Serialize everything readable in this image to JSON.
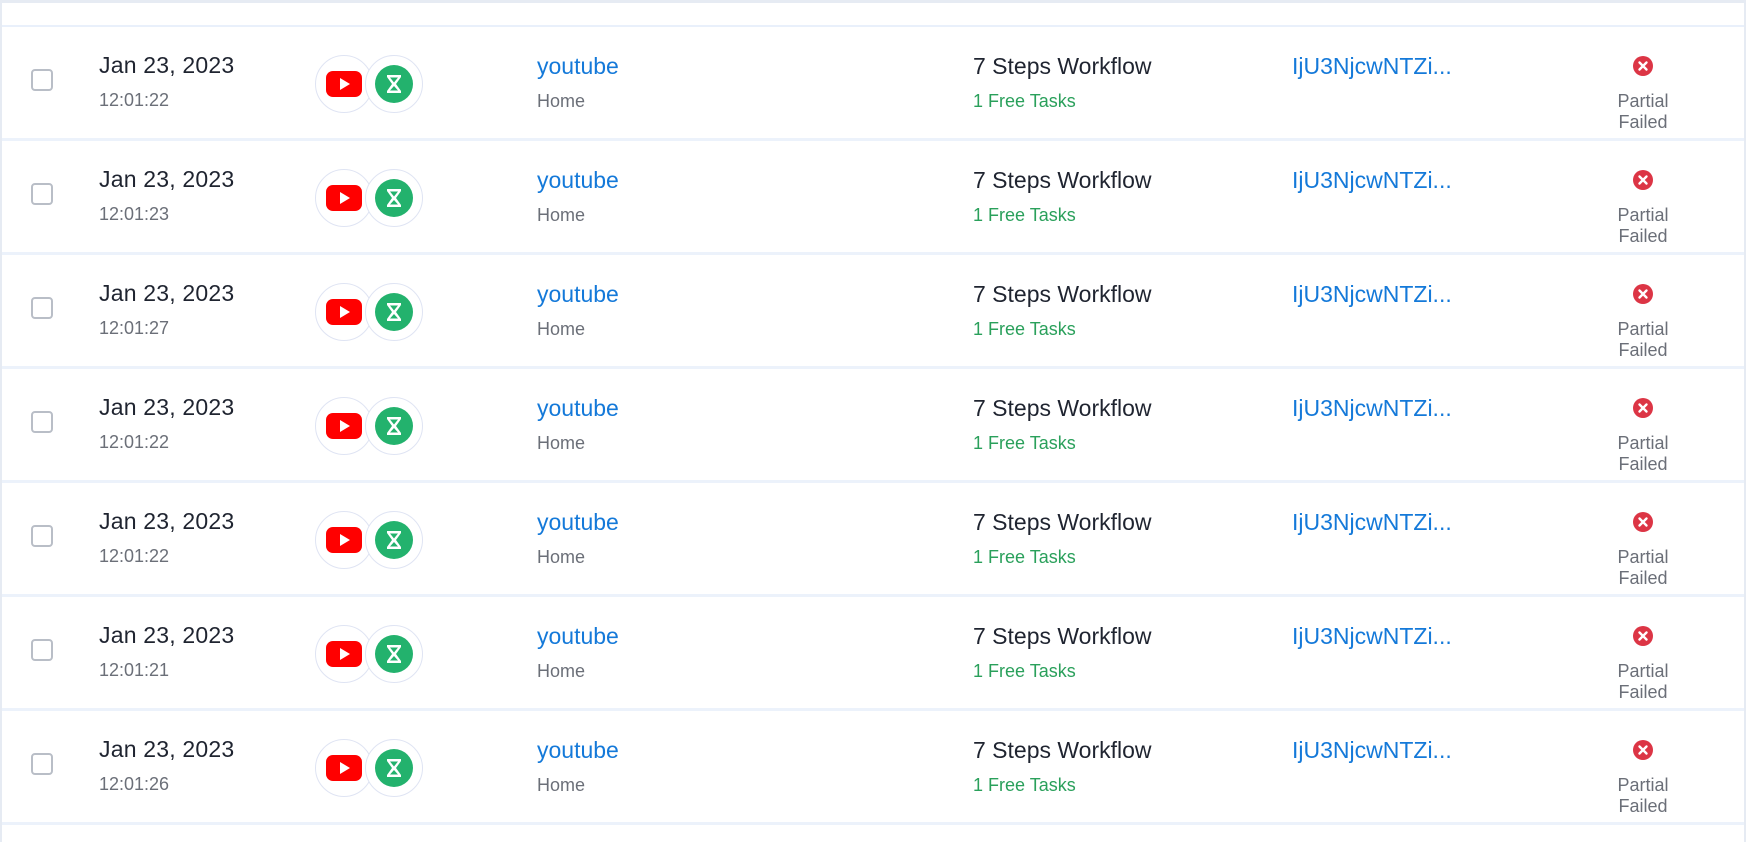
{
  "rows": [
    {
      "date": "Jan 23, 2023",
      "time": "12:01:22",
      "app": "youtube",
      "app_sub": "Home",
      "workflow": "7 Steps Workflow",
      "tasks": "1 Free Tasks",
      "run_id": "IjU3NjcwNTZi...",
      "status": "Partial Failed"
    },
    {
      "date": "Jan 23, 2023",
      "time": "12:01:23",
      "app": "youtube",
      "app_sub": "Home",
      "workflow": "7 Steps Workflow",
      "tasks": "1 Free Tasks",
      "run_id": "IjU3NjcwNTZi...",
      "status": "Partial Failed"
    },
    {
      "date": "Jan 23, 2023",
      "time": "12:01:27",
      "app": "youtube",
      "app_sub": "Home",
      "workflow": "7 Steps Workflow",
      "tasks": "1 Free Tasks",
      "run_id": "IjU3NjcwNTZi...",
      "status": "Partial Failed"
    },
    {
      "date": "Jan 23, 2023",
      "time": "12:01:22",
      "app": "youtube",
      "app_sub": "Home",
      "workflow": "7 Steps Workflow",
      "tasks": "1 Free Tasks",
      "run_id": "IjU3NjcwNTZi...",
      "status": "Partial Failed"
    },
    {
      "date": "Jan 23, 2023",
      "time": "12:01:22",
      "app": "youtube",
      "app_sub": "Home",
      "workflow": "7 Steps Workflow",
      "tasks": "1 Free Tasks",
      "run_id": "IjU3NjcwNTZi...",
      "status": "Partial Failed"
    },
    {
      "date": "Jan 23, 2023",
      "time": "12:01:21",
      "app": "youtube",
      "app_sub": "Home",
      "workflow": "7 Steps Workflow",
      "tasks": "1 Free Tasks",
      "run_id": "IjU3NjcwNTZi...",
      "status": "Partial Failed"
    },
    {
      "date": "Jan 23, 2023",
      "time": "12:01:26",
      "app": "youtube",
      "app_sub": "Home",
      "workflow": "7 Steps Workflow",
      "tasks": "1 Free Tasks",
      "run_id": "IjU3NjcwNTZi...",
      "status": "Partial Failed"
    }
  ],
  "icons": {
    "app_icon": "youtube-icon",
    "workflow_icon": "hourglass-icon",
    "status_icon": "error-x-icon"
  },
  "colors": {
    "link": "#1479d9",
    "success_green": "#2aa05b",
    "error_red": "#dc3545",
    "youtube_red": "#ff0000",
    "hourglass_green": "#23b26d"
  }
}
